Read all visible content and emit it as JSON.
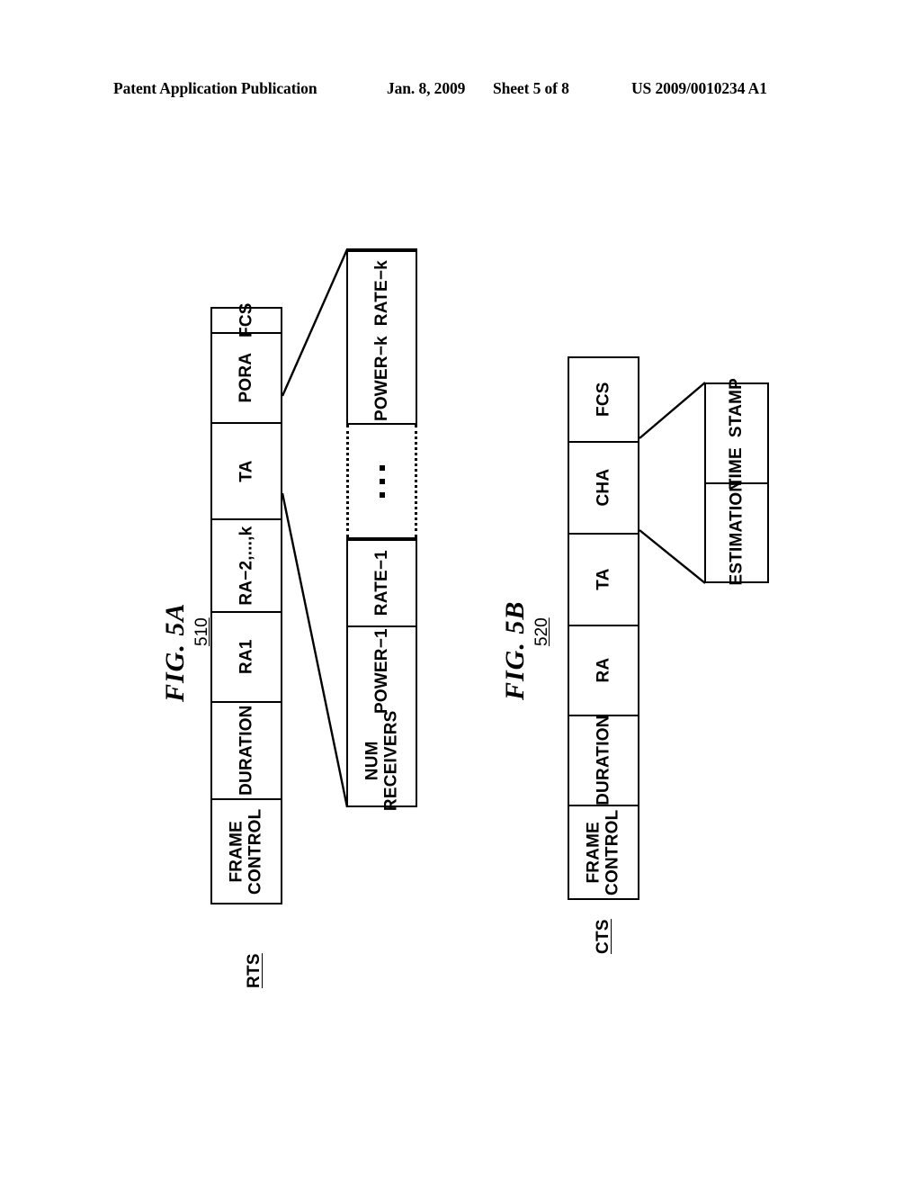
{
  "header": {
    "publication": "Patent Application Publication",
    "date": "Jan. 8, 2009",
    "sheet": "Sheet 5 of 8",
    "patent_number": "US 2009/0010234 A1"
  },
  "figures": [
    {
      "title": "FIG.  5A",
      "reference": "510",
      "frame_label": "RTS",
      "frame_fields": [
        "FRAME\nCONTROL",
        "DURATION",
        "RA1",
        "RA-2,...,k",
        "TA",
        "PORA",
        "FCS"
      ],
      "detail_of": "PORA",
      "detail_lower_fields": [
        "NUM\nRECEIVERS",
        "POWER-1",
        "RATE-1"
      ],
      "detail_gap": "...",
      "detail_upper_fields": [
        "POWER-k",
        "RATE-k"
      ]
    },
    {
      "title": "FIG.  5B",
      "reference": "520",
      "frame_label": "CTS",
      "frame_fields": [
        "FRAME\nCONTROL",
        "DURATION",
        "RA",
        "TA",
        "CHA",
        "FCS"
      ],
      "detail_of": "CHA",
      "detail_fields": [
        "ESTIMATION",
        "TIME  STAMP"
      ]
    }
  ],
  "colors": {
    "ink": "#000000",
    "paper": "#ffffff"
  }
}
